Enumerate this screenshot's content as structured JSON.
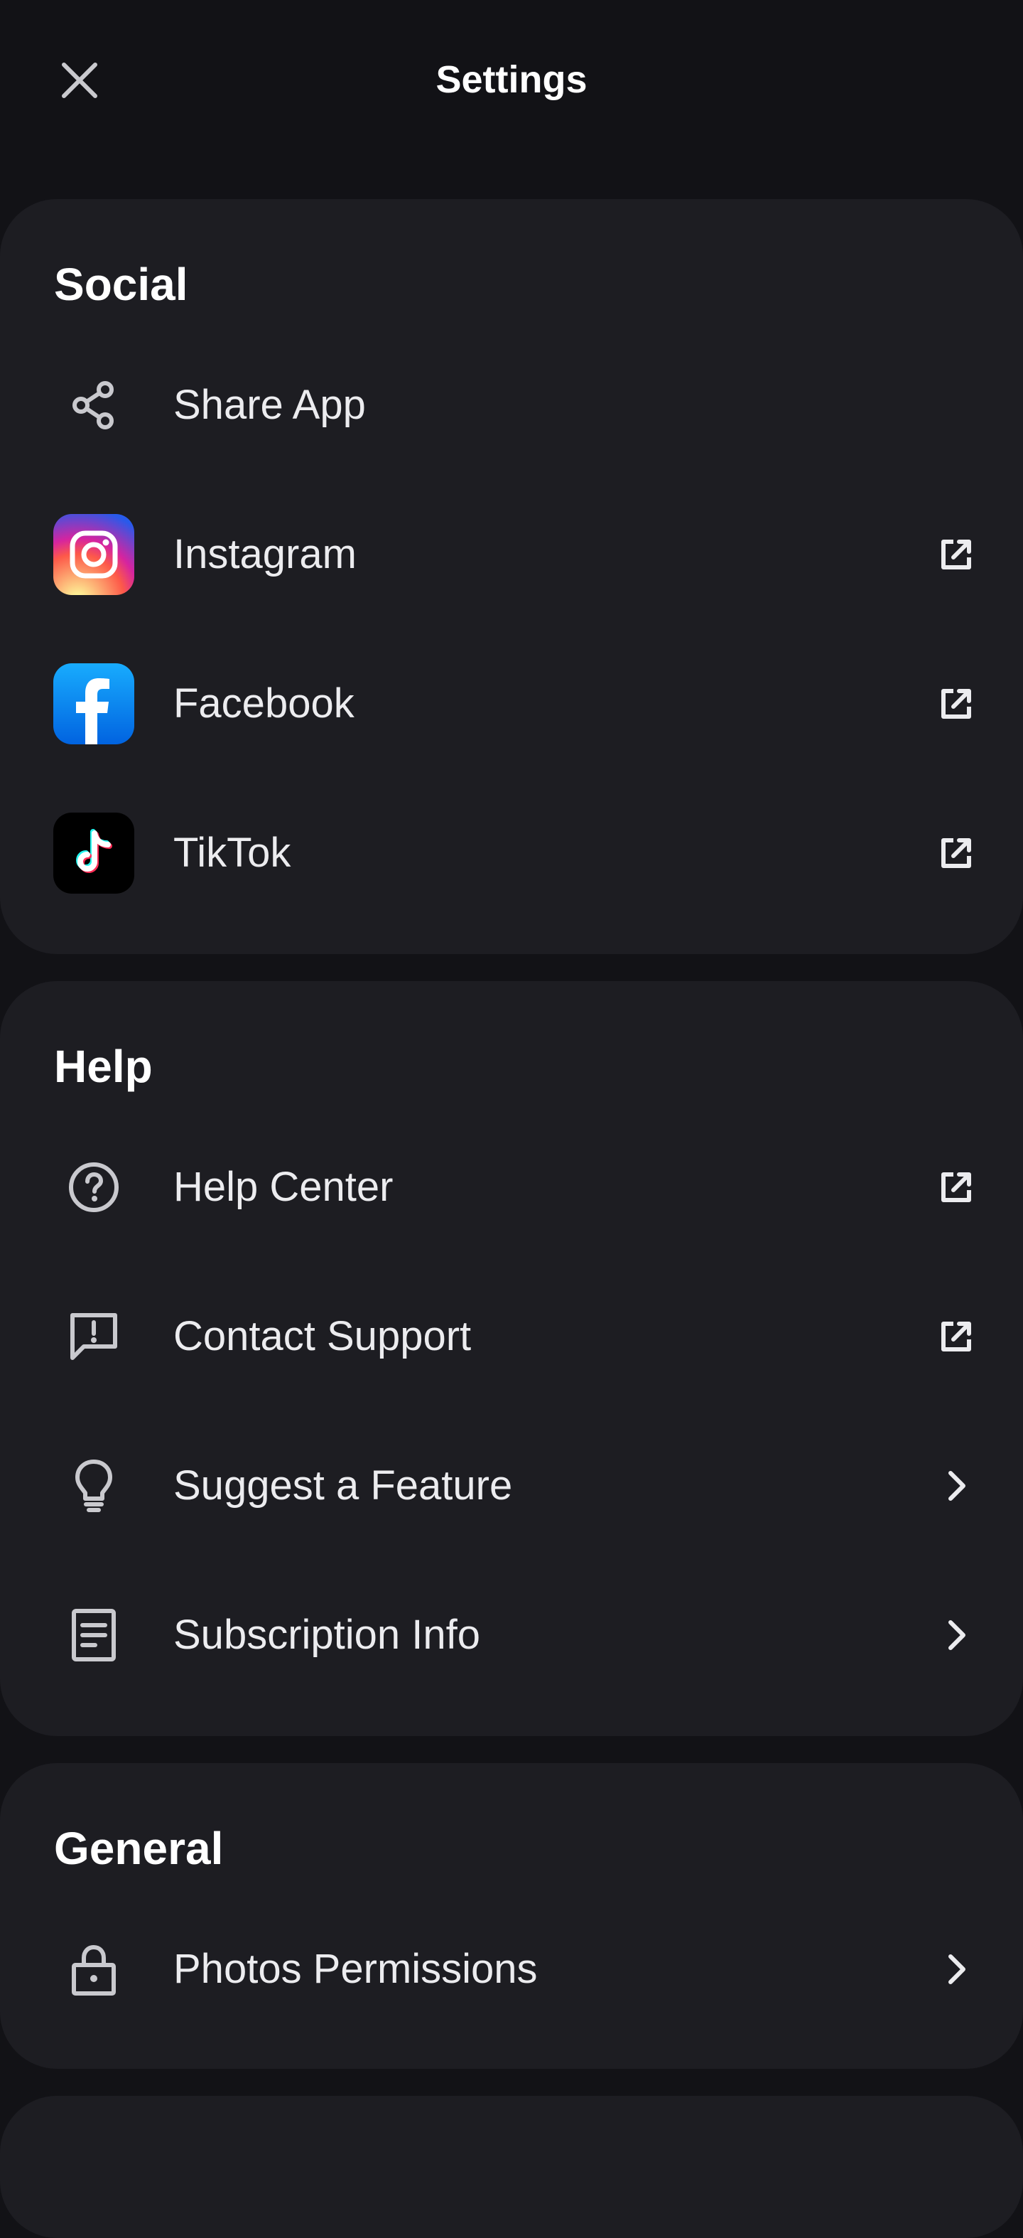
{
  "header": {
    "title": "Settings",
    "close_icon": "close-icon"
  },
  "colors": {
    "background": "#121216",
    "card": "#1d1d22",
    "text": "#ececef",
    "icon": "#c9c9ce"
  },
  "social": {
    "title": "Social",
    "items": [
      {
        "label": "Share App",
        "icon": "share-icon",
        "trailing": "none"
      },
      {
        "label": "Instagram",
        "icon": "instagram-icon",
        "trailing": "external-link-icon"
      },
      {
        "label": "Facebook",
        "icon": "facebook-icon",
        "trailing": "external-link-icon"
      },
      {
        "label": "TikTok",
        "icon": "tiktok-icon",
        "trailing": "external-link-icon"
      }
    ]
  },
  "help": {
    "title": "Help",
    "items": [
      {
        "label": "Help Center",
        "icon": "question-circle-icon",
        "trailing": "external-link-icon"
      },
      {
        "label": "Contact Support",
        "icon": "chat-alert-icon",
        "trailing": "external-link-icon"
      },
      {
        "label": "Suggest a Feature",
        "icon": "lightbulb-icon",
        "trailing": "chevron-right-icon"
      },
      {
        "label": "Subscription Info",
        "icon": "document-icon",
        "trailing": "chevron-right-icon"
      }
    ]
  },
  "general": {
    "title": "General",
    "items": [
      {
        "label": "Photos Permissions",
        "icon": "lock-icon",
        "trailing": "chevron-right-icon"
      }
    ]
  }
}
